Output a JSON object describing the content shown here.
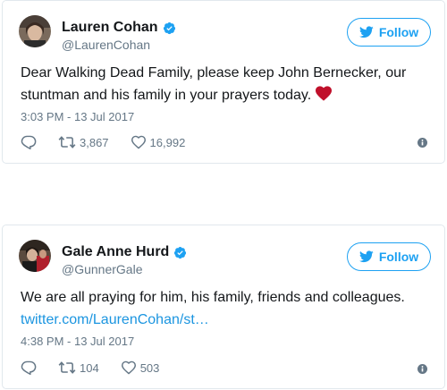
{
  "tweets": [
    {
      "display_name": "Lauren Cohan",
      "handle": "@LaurenCohan",
      "follow_label": "Follow",
      "text": "Dear Walking Dead Family, please keep John Bernecker, our stuntman and his family in your prayers today.",
      "link": "",
      "timestamp": "3:03 PM - 13 Jul 2017",
      "retweets": "3,867",
      "likes": "16,992",
      "icons": [
        "verified-icon",
        "twitter-bird-icon",
        "red-heart-emoji",
        "reply-icon",
        "retweet-icon",
        "like-icon",
        "info-icon"
      ]
    },
    {
      "display_name": "Gale Anne Hurd",
      "handle": "@GunnerGale",
      "follow_label": "Follow",
      "text": "We are all praying for him, his family, friends and colleagues.",
      "link": "twitter.com/LaurenCohan/st…",
      "timestamp": "4:38 PM - 13 Jul 2017",
      "retweets": "104",
      "likes": "503",
      "icons": [
        "verified-icon",
        "twitter-bird-icon",
        "reply-icon",
        "retweet-icon",
        "like-icon",
        "info-icon"
      ]
    }
  ],
  "colors": {
    "brand_blue": "#1da1f2",
    "link_blue": "#1b95e0",
    "secondary_text": "#657786",
    "heart_red": "#c0102b",
    "border": "#e1e8ed"
  }
}
